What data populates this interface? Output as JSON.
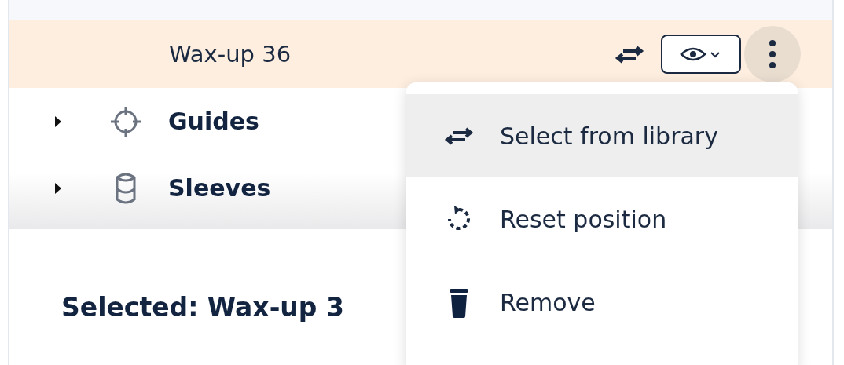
{
  "row": {
    "label": "Wax-up 36",
    "selected": true
  },
  "tree": [
    {
      "label": "Guides",
      "expanded": false,
      "kind": "guides"
    },
    {
      "label": "Sleeves",
      "expanded": false,
      "kind": "sleeves"
    }
  ],
  "selection_text": "Selected: Wax-up 3",
  "menu": {
    "open": true,
    "items": [
      {
        "label": "Select from library",
        "kind": "swap",
        "selected": true
      },
      {
        "label": "Reset position",
        "kind": "reset",
        "selected": false
      },
      {
        "label": "Remove",
        "kind": "trash",
        "selected": false
      }
    ]
  }
}
